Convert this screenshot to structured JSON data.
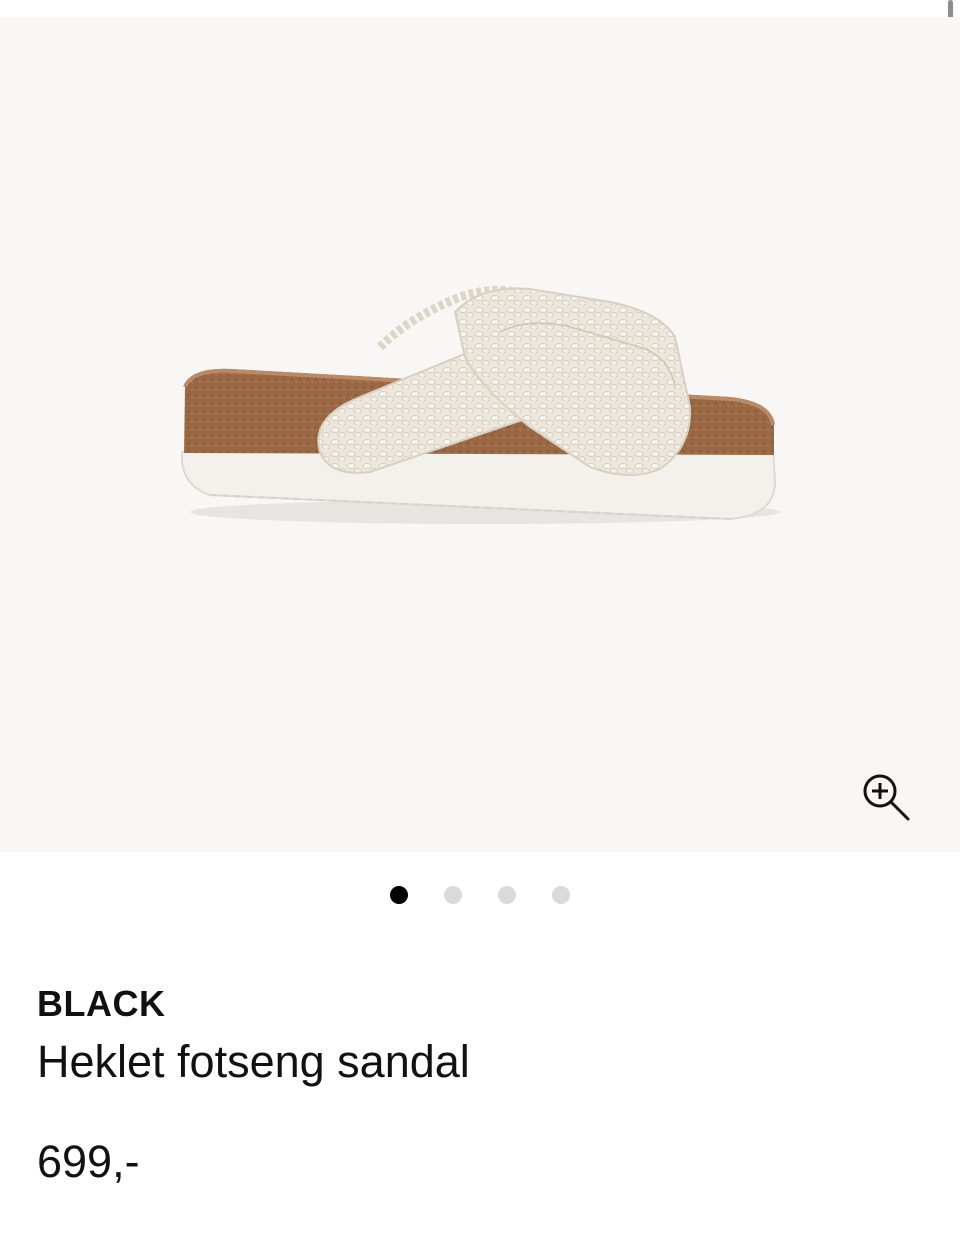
{
  "product": {
    "brand": "BLACK",
    "name": "Heklet fotseng sandal",
    "price": "699,-"
  },
  "gallery": {
    "image_count": 4,
    "active_index": 0,
    "zoom_icon": "zoom-in-icon",
    "background_color": "#f8f7f5"
  },
  "colors": {
    "text": "#111111",
    "dot_active": "#000000",
    "dot_inactive": "#dadada"
  }
}
